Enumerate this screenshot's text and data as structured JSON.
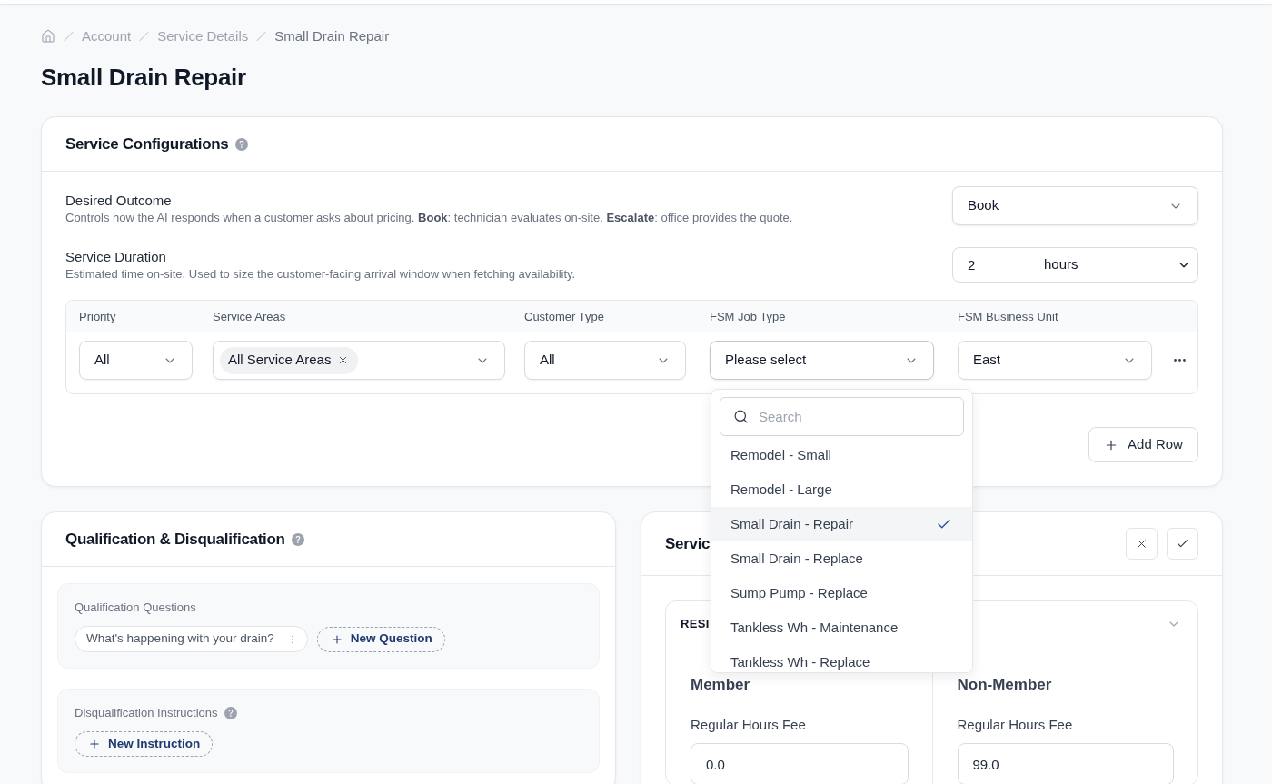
{
  "breadcrumb": [
    "Account",
    "Service Details",
    "Small Drain Repair"
  ],
  "page_title": "Small Drain Repair",
  "service_configurations": {
    "title": "Service Configurations",
    "help": true,
    "settings": [
      {
        "kind": "select",
        "label": "Desired Outcome",
        "description": "Controls how the AI responds when a customer asks about pricing. **Book**: technician evaluates on-site. **Escalate**: office provides the quote.",
        "value": "Book"
      },
      {
        "kind": "duration",
        "label": "Service Duration",
        "description": "Estimated time on-site. Used to size the customer-facing arrival window when fetching availability.",
        "value": "2",
        "unit": "hours"
      }
    ],
    "table": {
      "columns": [
        "Priority",
        "Service Areas",
        "Customer Type",
        "FSM Job Type",
        "FSM Business Unit"
      ],
      "rows": [
        {
          "cells": [
            {
              "kind": "select",
              "value": "All",
              "expanded": false
            },
            {
              "kind": "multi_select",
              "chips": [
                "All Service Areas"
              ],
              "expanded": false
            },
            {
              "kind": "select",
              "value": "All",
              "expanded": false
            },
            {
              "kind": "select",
              "value": "Please select",
              "expanded": true,
              "search_placeholder": "Search",
              "options": [
                {
                  "label": "Remodel - Small",
                  "selected": false
                },
                {
                  "label": "Remodel - Large",
                  "selected": false
                },
                {
                  "label": "Small Drain - Repair",
                  "selected": true
                },
                {
                  "label": "Small Drain - Replace",
                  "selected": false
                },
                {
                  "label": "Sump Pump - Replace",
                  "selected": false
                },
                {
                  "label": "Tankless Wh - Maintenance",
                  "selected": false
                },
                {
                  "label": "Tankless Wh - Replace",
                  "selected": false
                }
              ]
            },
            {
              "kind": "select",
              "value": "East",
              "expanded": false
            }
          ]
        }
      ]
    },
    "add_row_button": "Add Row"
  },
  "qualification": {
    "title": "Qualification & Disqualification",
    "help": true,
    "sections": [
      {
        "label": "Qualification Questions",
        "help": false,
        "items": [
          "What's happening with your drain?"
        ],
        "add_button": "New Question"
      },
      {
        "label": "Disqualification Instructions",
        "help": true,
        "add_button": "New Instruction"
      }
    ]
  },
  "service_pricing": {
    "title": "Servic",
    "segment": {
      "title": "RESI",
      "columns": [
        {
          "title": "Member",
          "fields": [
            {
              "label": "Regular Hours Fee",
              "value": "0.0"
            }
          ]
        },
        {
          "title": "Non-Member",
          "fields": [
            {
              "label": "Regular Hours Fee",
              "value": "99.0"
            }
          ]
        }
      ]
    }
  }
}
